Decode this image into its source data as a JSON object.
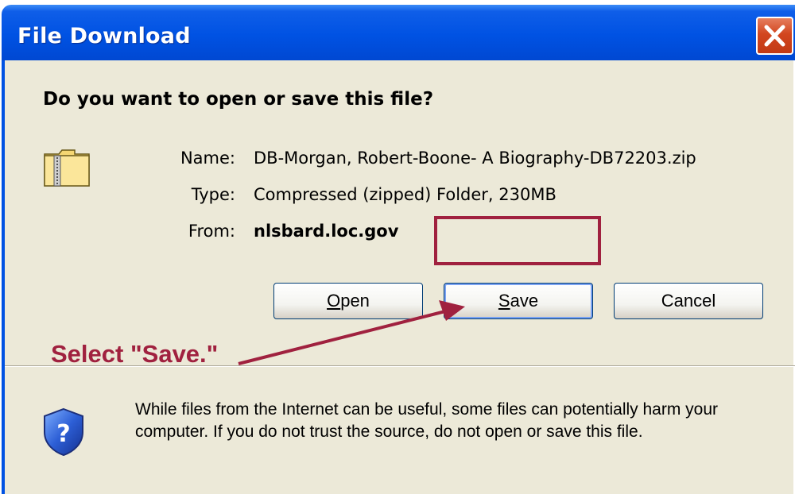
{
  "window": {
    "title": "File Download",
    "close_icon": "close-icon"
  },
  "dialog": {
    "question": "Do you want to open or save this file?",
    "file_icon": "zip-folder-icon",
    "fields": {
      "name_label": "Name:",
      "name_value": "DB-Morgan, Robert-Boone- A Biography-DB72203.zip",
      "type_label": "Type:",
      "type_value": "Compressed (zipped) Folder, 230MB",
      "from_label": "From:",
      "from_value": "nlsbard.loc.gov"
    },
    "buttons": {
      "open_prefix": "O",
      "open_rest": "pen",
      "save_prefix": "S",
      "save_rest": "ave",
      "cancel": "Cancel"
    },
    "annotation": {
      "text": "Select \"Save.\"",
      "color": "#a0213f"
    },
    "warning": {
      "icon": "shield-question-icon",
      "text": "While files from the Internet can be useful, some files can potentially harm your computer. If you do not trust the source, do not open or save this file."
    }
  },
  "colors": {
    "titlebar": "#0052e3",
    "body": "#ece9d8",
    "close": "#d2461f"
  }
}
